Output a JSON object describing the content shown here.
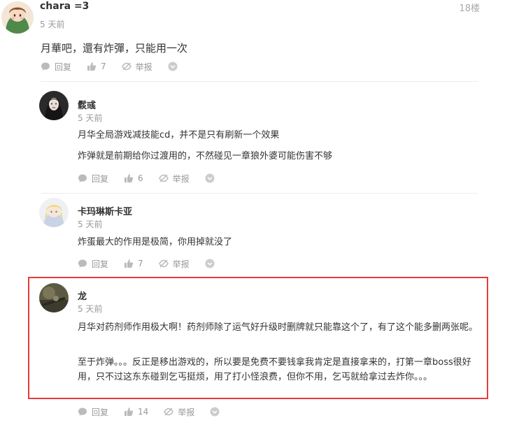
{
  "main_comment": {
    "username": "chara =3",
    "time": "5 天前",
    "floor": "18楼",
    "content": "月華吧，還有炸彈，只能用一次",
    "actions": {
      "reply": "回复",
      "like_count": "7",
      "report": "举报"
    }
  },
  "replies": [
    {
      "username": "鬏彧",
      "time": "5 天前",
      "paragraphs": [
        "月华全局游戏减技能cd，并不是只有刷新一个效果",
        "炸弹就是前期给你过渡用的，不然碰见一章狼外婆可能伤害不够"
      ],
      "reply": "回复",
      "like_count": "6",
      "report": "举报"
    },
    {
      "username": "卡玛琳斯卡亚",
      "time": "5 天前",
      "paragraphs": [
        "炸蛋最大的作用是极简，你用掉就没了"
      ],
      "reply": "回复",
      "like_count": "7",
      "report": "举报"
    },
    {
      "username": "龙",
      "time": "5 天前",
      "paragraphs": [
        "月华对药剂师作用极大啊！药剂师除了运气好升级时删牌就只能靠这个了，有了这个能多删两张呢。",
        "至于炸弹。。。反正是移出游戏的，所以要是免费不要钱拿我肯定是直接拿来的，打第一章boss很好用，只不过这东东碰到乞丐挺烦，用了打小怪浪费，但你不用，乞丐就给拿过去炸你。。。"
      ],
      "reply": "回复",
      "like_count": "14",
      "report": "举报"
    }
  ],
  "colors": {
    "highlight": "#e83a3a",
    "muted": "#999999",
    "text": "#333333"
  }
}
